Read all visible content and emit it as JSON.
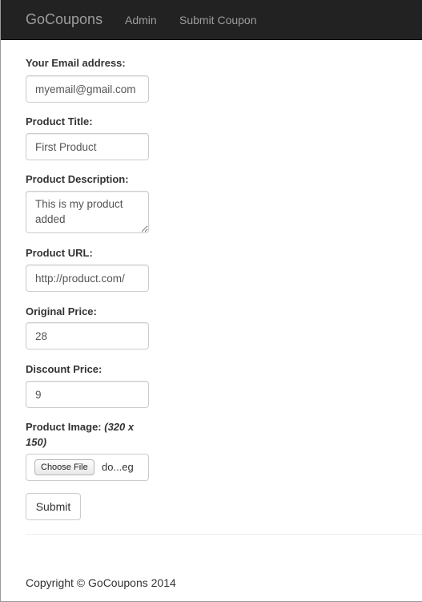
{
  "navbar": {
    "brand": "GoCoupons",
    "links": [
      "Admin",
      "Submit Coupon"
    ]
  },
  "form": {
    "email": {
      "label": "Your Email address:",
      "value": "myemail@gmail.com"
    },
    "title": {
      "label": "Product Title:",
      "value": "First Product"
    },
    "description": {
      "label": "Product Description:",
      "value": "This is my product added"
    },
    "url": {
      "label": "Product URL:",
      "value": "http://product.com/"
    },
    "original_price": {
      "label": "Original Price:",
      "value": "28"
    },
    "discount_price": {
      "label": "Discount Price:",
      "value": "9"
    },
    "image": {
      "label": "Product Image:",
      "hint": "(320 x 150)",
      "button_label": "Choose File",
      "file_name": "do...eg"
    },
    "submit_label": "Submit"
  },
  "footer": {
    "copyright": "Copyright © GoCoupons 2014"
  }
}
